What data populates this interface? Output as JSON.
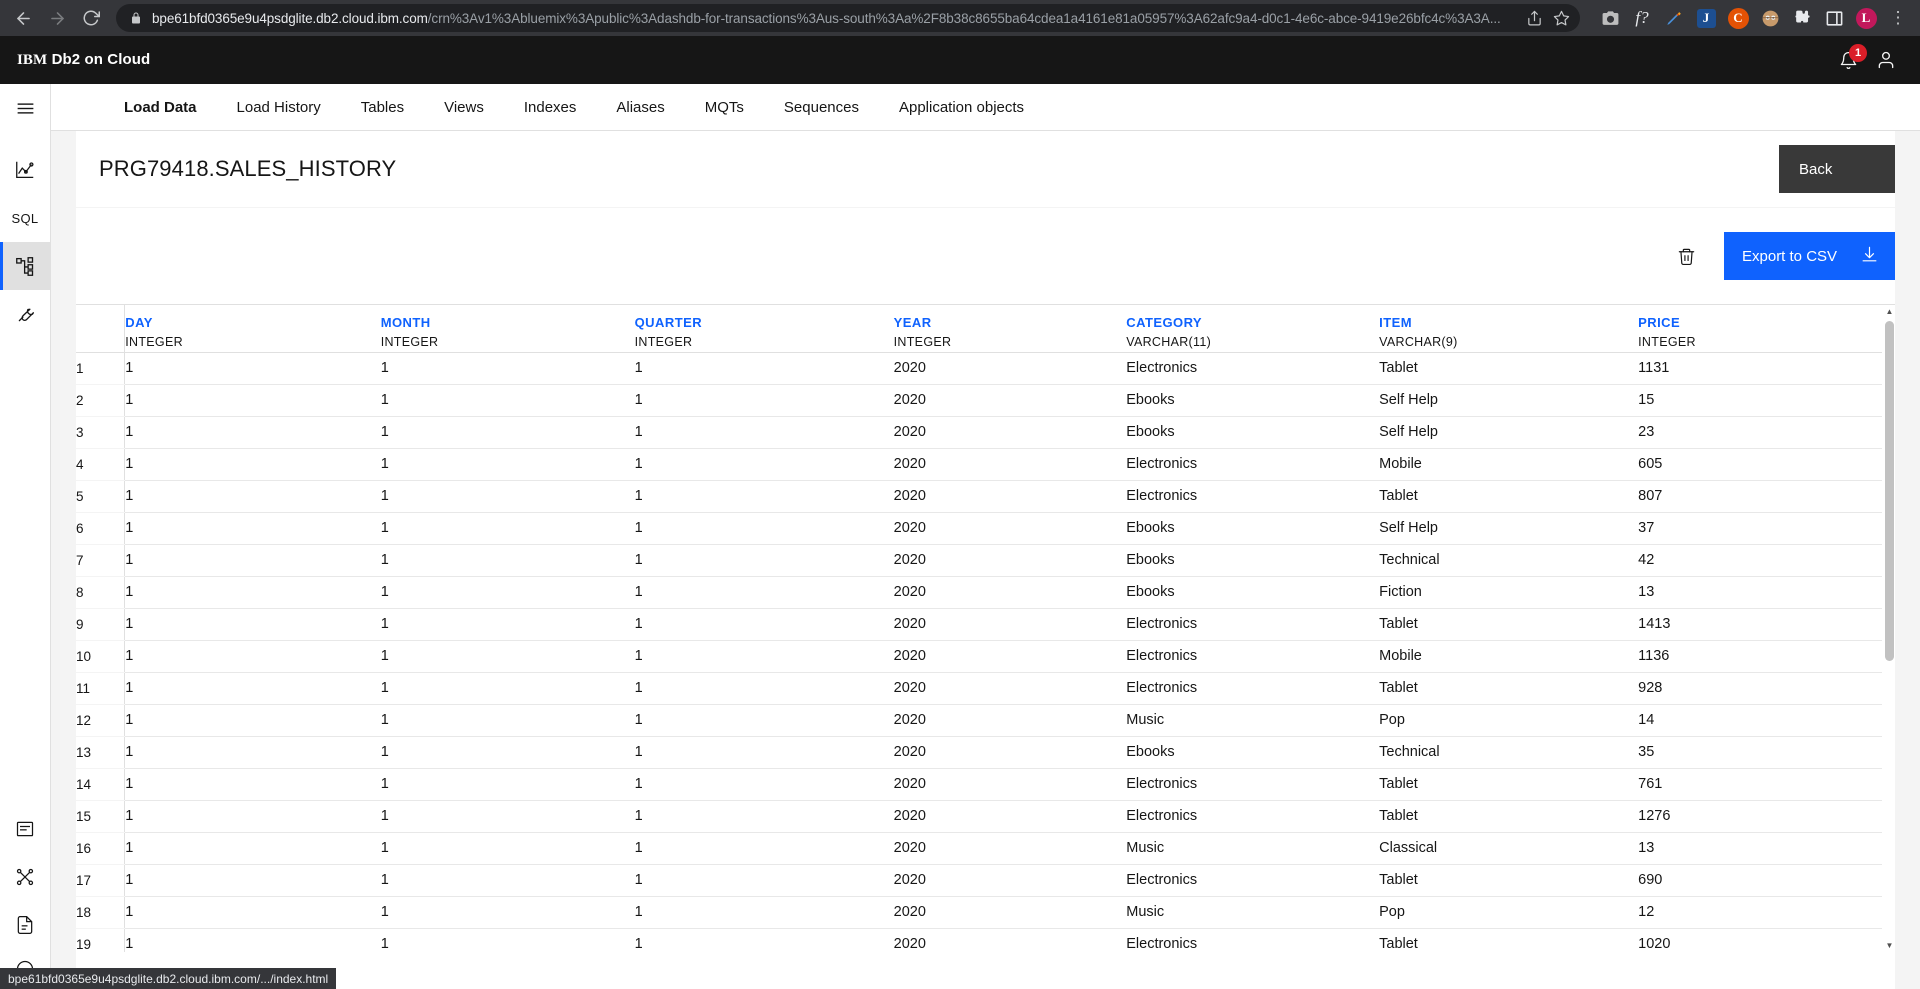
{
  "browser": {
    "url_host": "bpe61bfd0365e9u4psdglite.db2.cloud.ibm.com",
    "url_path": "/crn%3Av1%3Abluemix%3Apublic%3Adashdb-for-transactions%3Aus-south%3Aa%2F8b38c8655ba64cdea1a4161e81a05957%3A62afc9a4-d0c1-4e6c-abce-9419e26bfc4c%3A3A...",
    "back_icon": "back-arrow-icon",
    "forward_icon": "forward-arrow-icon",
    "reload_icon": "reload-icon",
    "lock_icon": "lock-icon",
    "share_icon": "share-icon",
    "bookmark_icon": "star-icon",
    "extensions": [
      {
        "name": "camera-extension-icon",
        "glyph": "▣",
        "kind": "camera"
      },
      {
        "name": "math-formula-extension-icon",
        "glyph": "f?",
        "kind": "text"
      },
      {
        "name": "eyedropper-extension-icon",
        "glyph": "✎",
        "kind": "pen"
      },
      {
        "name": "j-extension-icon",
        "glyph": "J",
        "kind": "square",
        "color": "#1d4f91"
      },
      {
        "name": "c-extension-icon",
        "glyph": "C",
        "kind": "circle",
        "color": "#e35205"
      },
      {
        "name": "avatar-extension-icon",
        "glyph": "●",
        "kind": "avatar"
      },
      {
        "name": "puzzle-extensions-icon",
        "glyph": "✦",
        "kind": "puzzle"
      },
      {
        "name": "sidepanel-icon",
        "glyph": "■",
        "kind": "panel"
      },
      {
        "name": "profile-avatar",
        "glyph": "L",
        "kind": "circle",
        "color": "#c2185b"
      },
      {
        "name": "chrome-menu-icon",
        "glyph": "⋮",
        "kind": "menu"
      }
    ],
    "status_url": "bpe61bfd0365e9u4psdglite.db2.cloud.ibm.com/.../index.html"
  },
  "app_header": {
    "brand_prefix": "IBM",
    "brand_name": "Db2 on Cloud",
    "notification_count": "1",
    "notification_icon": "bell-icon",
    "user_icon": "user-avatar-icon"
  },
  "rail": {
    "items": [
      {
        "name": "hamburger-menu-icon",
        "label": "Menu",
        "active": false
      },
      {
        "name": "monitoring-chart-icon",
        "label": "Monitoring",
        "active": false
      },
      {
        "name": "sql-icon",
        "label": "SQL",
        "active": false
      },
      {
        "name": "data-objects-icon",
        "label": "Data",
        "active": true
      },
      {
        "name": "settings-wrench-icon",
        "label": "Administration",
        "active": false
      },
      {
        "name": "console-icon",
        "label": "Console",
        "active": false
      },
      {
        "name": "connections-icon",
        "label": "Connections",
        "active": false
      },
      {
        "name": "documents-icon",
        "label": "Documents",
        "active": false
      }
    ]
  },
  "tabs": [
    {
      "label": "Load Data",
      "active": true
    },
    {
      "label": "Load History",
      "active": false
    },
    {
      "label": "Tables",
      "active": false
    },
    {
      "label": "Views",
      "active": false
    },
    {
      "label": "Indexes",
      "active": false
    },
    {
      "label": "Aliases",
      "active": false
    },
    {
      "label": "MQTs",
      "active": false
    },
    {
      "label": "Sequences",
      "active": false
    },
    {
      "label": "Application objects",
      "active": false
    }
  ],
  "page": {
    "title": "PRG79418.SALES_HISTORY",
    "back_label": "Back",
    "delete_icon": "trash-icon",
    "export_label": "Export to CSV",
    "export_icon": "download-icon",
    "accent_color": "#0f62fe",
    "back_button_color": "#393939"
  },
  "grid": {
    "columns": [
      {
        "name": "DAY",
        "type": "INTEGER"
      },
      {
        "name": "MONTH",
        "type": "INTEGER"
      },
      {
        "name": "QUARTER",
        "type": "INTEGER"
      },
      {
        "name": "YEAR",
        "type": "INTEGER"
      },
      {
        "name": "CATEGORY",
        "type": "VARCHAR(11)"
      },
      {
        "name": "ITEM",
        "type": "VARCHAR(9)"
      },
      {
        "name": "PRICE",
        "type": "INTEGER"
      }
    ],
    "rows": [
      {
        "n": "1",
        "day": "1",
        "month": "1",
        "quarter": "1",
        "year": "2020",
        "category": "Electronics",
        "item": "Tablet",
        "price": "1131"
      },
      {
        "n": "2",
        "day": "1",
        "month": "1",
        "quarter": "1",
        "year": "2020",
        "category": "Ebooks",
        "item": "Self Help",
        "price": "15"
      },
      {
        "n": "3",
        "day": "1",
        "month": "1",
        "quarter": "1",
        "year": "2020",
        "category": "Ebooks",
        "item": "Self Help",
        "price": "23"
      },
      {
        "n": "4",
        "day": "1",
        "month": "1",
        "quarter": "1",
        "year": "2020",
        "category": "Electronics",
        "item": "Mobile",
        "price": "605"
      },
      {
        "n": "5",
        "day": "1",
        "month": "1",
        "quarter": "1",
        "year": "2020",
        "category": "Electronics",
        "item": "Tablet",
        "price": "807"
      },
      {
        "n": "6",
        "day": "1",
        "month": "1",
        "quarter": "1",
        "year": "2020",
        "category": "Ebooks",
        "item": "Self Help",
        "price": "37"
      },
      {
        "n": "7",
        "day": "1",
        "month": "1",
        "quarter": "1",
        "year": "2020",
        "category": "Ebooks",
        "item": "Technical",
        "price": "42"
      },
      {
        "n": "8",
        "day": "1",
        "month": "1",
        "quarter": "1",
        "year": "2020",
        "category": "Ebooks",
        "item": "Fiction",
        "price": "13"
      },
      {
        "n": "9",
        "day": "1",
        "month": "1",
        "quarter": "1",
        "year": "2020",
        "category": "Electronics",
        "item": "Tablet",
        "price": "1413"
      },
      {
        "n": "10",
        "day": "1",
        "month": "1",
        "quarter": "1",
        "year": "2020",
        "category": "Electronics",
        "item": "Mobile",
        "price": "1136"
      },
      {
        "n": "11",
        "day": "1",
        "month": "1",
        "quarter": "1",
        "year": "2020",
        "category": "Electronics",
        "item": "Tablet",
        "price": "928"
      },
      {
        "n": "12",
        "day": "1",
        "month": "1",
        "quarter": "1",
        "year": "2020",
        "category": "Music",
        "item": "Pop",
        "price": "14"
      },
      {
        "n": "13",
        "day": "1",
        "month": "1",
        "quarter": "1",
        "year": "2020",
        "category": "Ebooks",
        "item": "Technical",
        "price": "35"
      },
      {
        "n": "14",
        "day": "1",
        "month": "1",
        "quarter": "1",
        "year": "2020",
        "category": "Electronics",
        "item": "Tablet",
        "price": "761"
      },
      {
        "n": "15",
        "day": "1",
        "month": "1",
        "quarter": "1",
        "year": "2020",
        "category": "Electronics",
        "item": "Tablet",
        "price": "1276"
      },
      {
        "n": "16",
        "day": "1",
        "month": "1",
        "quarter": "1",
        "year": "2020",
        "category": "Music",
        "item": "Classical",
        "price": "13"
      },
      {
        "n": "17",
        "day": "1",
        "month": "1",
        "quarter": "1",
        "year": "2020",
        "category": "Electronics",
        "item": "Tablet",
        "price": "690"
      },
      {
        "n": "18",
        "day": "1",
        "month": "1",
        "quarter": "1",
        "year": "2020",
        "category": "Music",
        "item": "Pop",
        "price": "12"
      },
      {
        "n": "19",
        "day": "1",
        "month": "1",
        "quarter": "1",
        "year": "2020",
        "category": "Electronics",
        "item": "Tablet",
        "price": "1020"
      }
    ]
  }
}
